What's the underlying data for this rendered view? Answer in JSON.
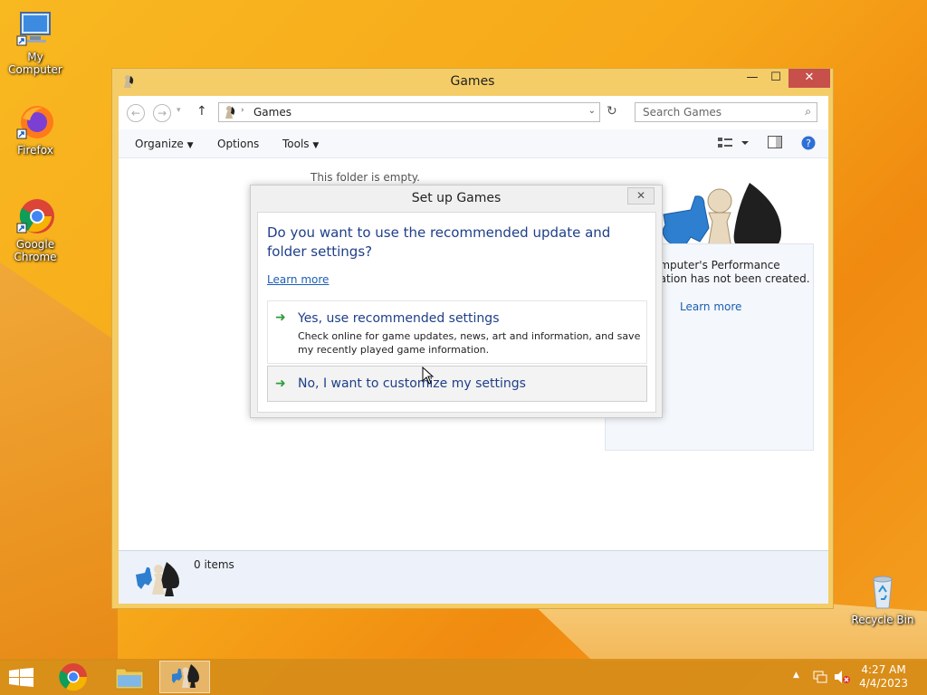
{
  "desktop": {
    "icons": [
      {
        "label": "My Computer",
        "icon": "computer-icon"
      },
      {
        "label": "Firefox",
        "icon": "firefox-icon"
      },
      {
        "label": "Google Chrome",
        "icon": "chrome-icon"
      },
      {
        "label": "Recycle Bin",
        "icon": "recycle-bin-icon"
      }
    ]
  },
  "window": {
    "title": "Games",
    "controls": {
      "minimize": "—",
      "maximize": "☐",
      "close": "✕"
    },
    "address": {
      "location": "Games"
    },
    "search": {
      "placeholder": "Search Games"
    },
    "toolbar": {
      "organize": "Organize",
      "options": "Options",
      "tools": "Tools"
    },
    "content": {
      "empty_message": "This folder is empty."
    },
    "perf_panel": {
      "text_line1": "omputer's Performance",
      "text_line2": "nation has not been created.",
      "learn_more": "Learn more"
    },
    "status": {
      "item_count": "0 items"
    }
  },
  "dialog": {
    "title": "Set up Games",
    "close": "✕",
    "question": "Do you want to use the recommended update and folder settings?",
    "learn_more": "Learn more",
    "option_yes": {
      "label": "Yes, use recommended settings",
      "description": "Check online for game updates, news, art and information, and save my recently played game information."
    },
    "option_no": {
      "label": "No, I want to customize my settings"
    }
  },
  "taskbar": {
    "clock_time": "4:27 AM",
    "clock_date": "4/4/2023",
    "apps": [
      "start-button",
      "chrome",
      "file-explorer",
      "games"
    ]
  },
  "colors": {
    "accent_close": "#c7504b",
    "link": "#1a5fb4",
    "dialog_heading": "#1e3f89",
    "arrow_green": "#2e9e39"
  }
}
